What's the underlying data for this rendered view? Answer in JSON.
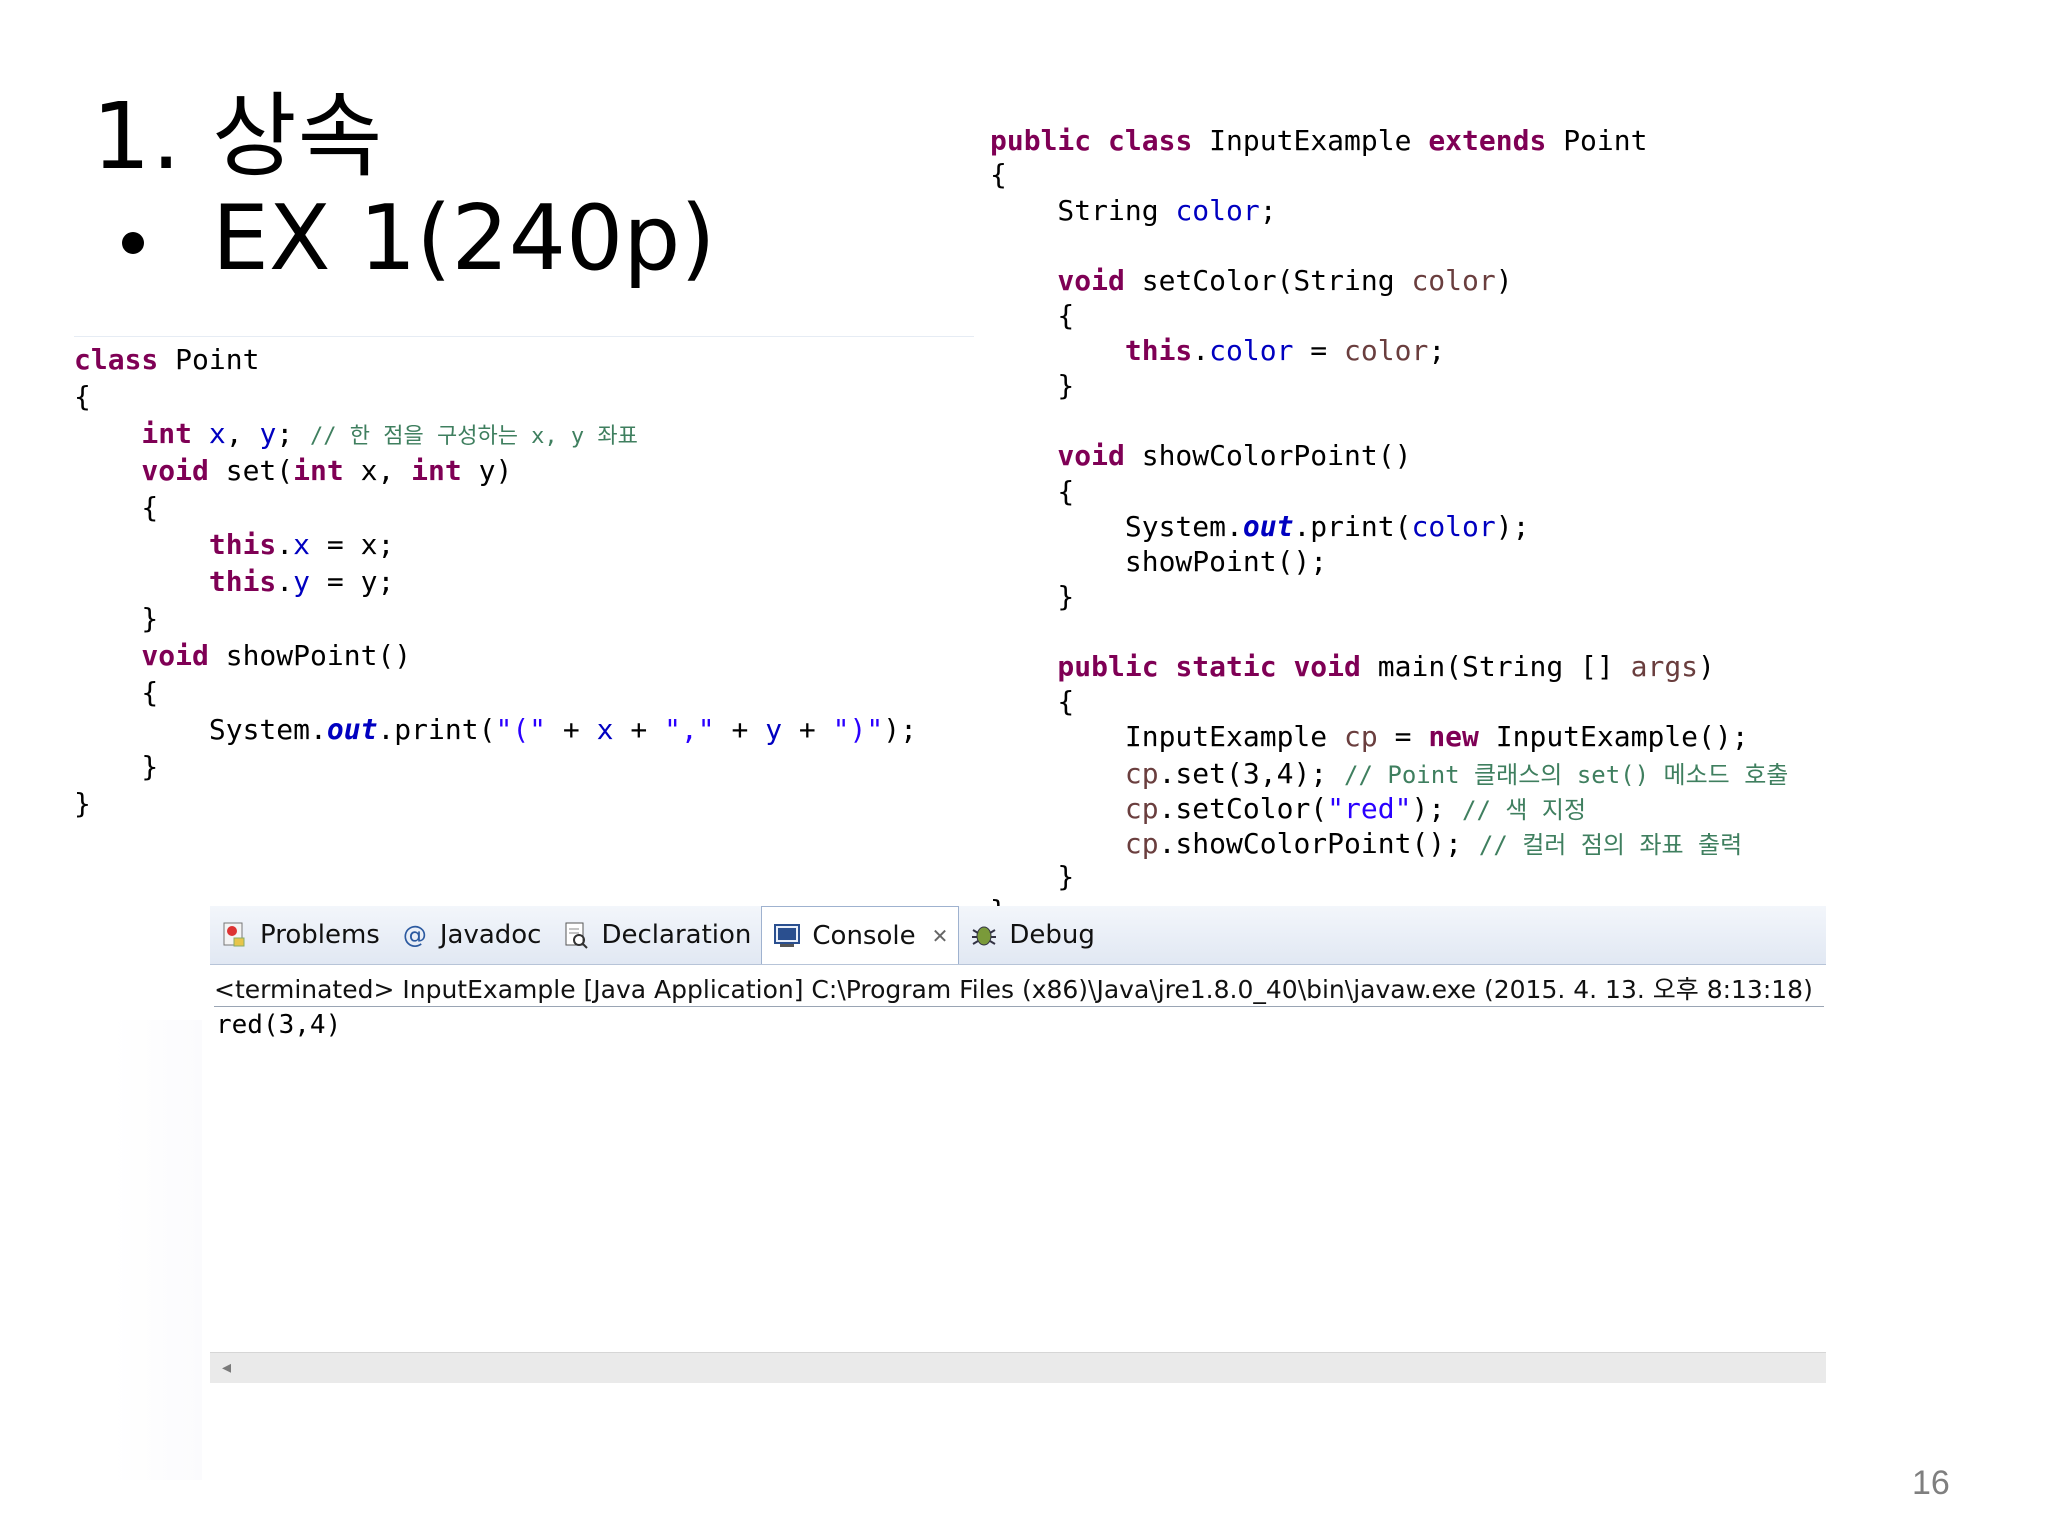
{
  "slide": {
    "title": "1. 상속",
    "bullet": "EX 1(240p)",
    "page_number": "16"
  },
  "code_left": {
    "l1": {
      "a": "class",
      "b": " Point"
    },
    "l2": {
      "a": "{"
    },
    "l3": {
      "a": "    int",
      "b": " x",
      "c": ", ",
      "d": "y",
      "e": "; ",
      "f": "// 한 점을 구성하는 x, y 좌표"
    },
    "l4": {
      "a": "    void",
      "b": " set(",
      "c": "int",
      "d": " x, ",
      "e": "int",
      "f": " y)"
    },
    "l5": {
      "a": "    {"
    },
    "l6": {
      "a": "        this",
      "b": ".",
      "c": "x",
      "d": " = x;"
    },
    "l7": {
      "a": "        this",
      "b": ".",
      "c": "y",
      "d": " = y;"
    },
    "l8": {
      "a": "    }"
    },
    "l9": {
      "a": "    void",
      "b": " showPoint()"
    },
    "l10": {
      "a": "    {"
    },
    "l11": {
      "a": "        System.",
      "b": "out",
      "c": ".print(",
      "d": "\"(\"",
      "e": " + ",
      "f": "x",
      "g": " + ",
      "h": "\",\"",
      "i": " + ",
      "j": "y",
      "k": " + ",
      "l": "\")\"",
      "m": ");"
    },
    "l12": {
      "a": "    }"
    },
    "l13": {
      "a": "}"
    }
  },
  "code_right": {
    "r1": {
      "a": "public",
      "b": " ",
      "c": "class",
      "d": " InputExample ",
      "e": "extends",
      "f": " Point"
    },
    "r2": {
      "a": "{"
    },
    "r3": {
      "a": "    String ",
      "b": "color",
      "c": ";"
    },
    "r4": {
      "a": "    void",
      "b": " setColor(String ",
      "c": "color",
      "d": ")"
    },
    "r5": {
      "a": "    {"
    },
    "r6": {
      "a": "        this",
      "b": ".",
      "c": "color",
      "d": " = ",
      "e": "color",
      "f": ";"
    },
    "r7": {
      "a": "    }"
    },
    "r8": {
      "a": "    void",
      "b": " showColorPoint()"
    },
    "r9": {
      "a": "    {"
    },
    "r10": {
      "a": "        System.",
      "b": "out",
      "c": ".print(",
      "d": "color",
      "e": ");"
    },
    "r11": {
      "a": "        showPoint();"
    },
    "r12": {
      "a": "    }"
    },
    "r13": {
      "a": "    public",
      "b": " ",
      "c": "static",
      "d": " ",
      "e": "void",
      "f": " main(String [] ",
      "g": "args",
      "h": ")"
    },
    "r14": {
      "a": "    {"
    },
    "r15": {
      "a": "        InputExample ",
      "b": "cp",
      "c": " = ",
      "d": "new",
      "e": " InputExample();"
    },
    "r16": {
      "a": "        cp",
      "b": ".set(3,4); ",
      "c": "// Point 클래스의 set() 메소드 호출"
    },
    "r17": {
      "a": "        cp",
      "b": ".setColor(",
      "c": "\"red\"",
      "d": "); ",
      "e": "// 색 지정"
    },
    "r18": {
      "a": "        cp",
      "b": ".showColorPoint(); ",
      "c": "// 컬러 점의 좌표 출력"
    },
    "r19": {
      "a": "    }"
    },
    "r20": {
      "a": "}"
    }
  },
  "console": {
    "tabs": {
      "problems": "Problems",
      "javadoc": "Javadoc",
      "declaration": "Declaration",
      "console": "Console",
      "close": "✕",
      "debug": "Debug"
    },
    "icons": {
      "problems": "problems-icon",
      "javadoc": "at-sign-icon",
      "declaration": "declaration-icon",
      "console": "console-icon",
      "debug": "debug-bug-icon"
    },
    "status": "<terminated> InputExample [Java Application] C:\\Program Files (x86)\\Java\\jre1.8.0_40\\bin\\javaw.exe (2015. 4. 13. 오후 8:13:18)",
    "output": "red(3,4)",
    "scroll_left": "◂"
  },
  "colors": {
    "keyword": "#7f0055",
    "field": "#0000c0",
    "string": "#2a00ff",
    "comment": "#3f7f5f"
  }
}
